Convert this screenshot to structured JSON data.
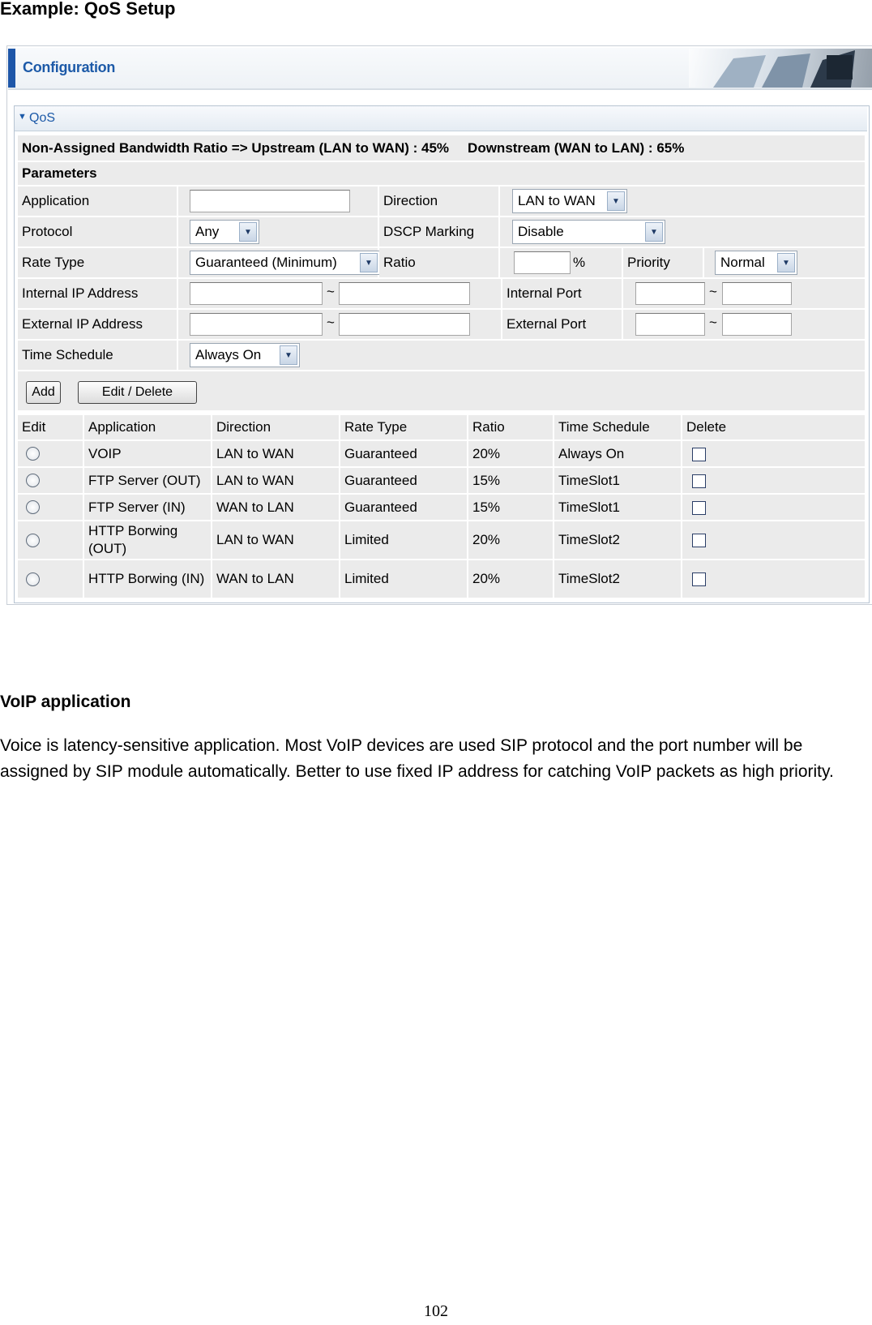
{
  "heading": "Example: QoS Setup",
  "config": {
    "title": "Configuration"
  },
  "qos": {
    "title": "QoS",
    "bandwidth_upstream": "Non-Assigned Bandwidth Ratio => Upstream (LAN to WAN) : 45%",
    "bandwidth_downstream": "Downstream (WAN to LAN) : 65%",
    "parameters_label": "Parameters",
    "labels": {
      "application": "Application",
      "direction": "Direction",
      "protocol": "Protocol",
      "dscp": "DSCP Marking",
      "rate_type": "Rate Type",
      "ratio": "Ratio",
      "percent": "%",
      "priority": "Priority",
      "internal_ip": "Internal IP Address",
      "internal_port": "Internal Port",
      "external_ip": "External IP Address",
      "external_port": "External Port",
      "time_schedule": "Time Schedule",
      "tilde": "~"
    },
    "values": {
      "direction": "LAN to WAN",
      "protocol": "Any",
      "dscp": "Disable",
      "rate_type": "Guaranteed (Minimum)",
      "priority": "Normal",
      "time_schedule": "Always On"
    },
    "buttons": {
      "add": "Add",
      "edit_delete": "Edit / Delete"
    },
    "table": {
      "headers": [
        "Edit",
        "Application",
        "Direction",
        "Rate Type",
        "Ratio",
        "Time Schedule",
        "Delete"
      ],
      "rows": [
        {
          "application": "VOIP",
          "direction": "LAN to WAN",
          "rate_type": "Guaranteed",
          "ratio": "20%",
          "schedule": "Always On"
        },
        {
          "application": "FTP Server (OUT)",
          "direction": "LAN to WAN",
          "rate_type": "Guaranteed",
          "ratio": "15%",
          "schedule": "TimeSlot1"
        },
        {
          "application": "FTP Server (IN)",
          "direction": "WAN to LAN",
          "rate_type": "Guaranteed",
          "ratio": "15%",
          "schedule": "TimeSlot1"
        },
        {
          "application": "HTTP Borwing (OUT)",
          "direction": "LAN to WAN",
          "rate_type": "Limited",
          "ratio": "20%",
          "schedule": "TimeSlot2"
        },
        {
          "application": "HTTP Borwing (IN)",
          "direction": "WAN to LAN",
          "rate_type": "Limited",
          "ratio": "20%",
          "schedule": "TimeSlot2"
        }
      ]
    }
  },
  "voip": {
    "heading": "VoIP application",
    "body": "Voice is latency-sensitive application. Most VoIP devices are used SIP protocol and the port number will be assigned by SIP module automatically. Better to use fixed IP address for catching VoIP packets as high priority."
  },
  "page_number": "102",
  "colors": {
    "accent": "#1d5aa8",
    "cell_bg": "#ebebeb"
  }
}
